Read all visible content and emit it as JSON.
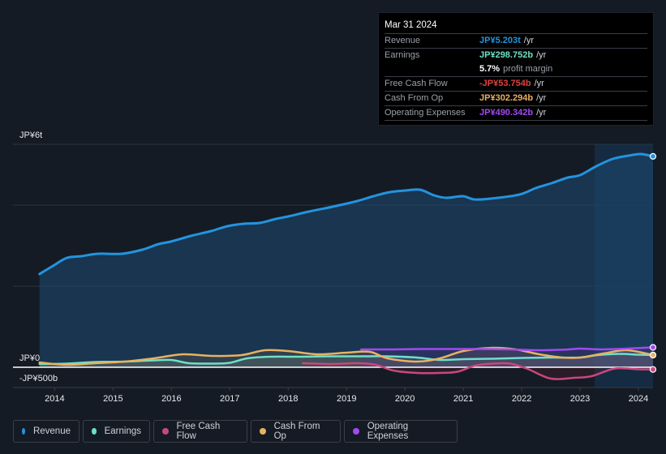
{
  "tooltip": {
    "date": "Mar 31 2024",
    "rows": [
      {
        "label": "Revenue",
        "value": "JP¥5.203t",
        "unit": "/yr",
        "color": "#2394df"
      },
      {
        "label": "Earnings",
        "value": "JP¥298.752b",
        "unit": "/yr",
        "color": "#6ee0c8"
      },
      {
        "label": "",
        "value": "5.7%",
        "unit": "profit margin"
      },
      {
        "label": "Free Cash Flow",
        "value": "-JP¥53.754b",
        "unit": "/yr",
        "color": "#e0413f"
      },
      {
        "label": "Cash From Op",
        "value": "JP¥302.294b",
        "unit": "/yr",
        "color": "#e8b161"
      },
      {
        "label": "Operating Expenses",
        "value": "JP¥490.342b",
        "unit": "/yr",
        "color": "#a349f0"
      }
    ]
  },
  "legend": [
    {
      "label": "Revenue",
      "color": "#2394df"
    },
    {
      "label": "Earnings",
      "color": "#6ee0c8"
    },
    {
      "label": "Free Cash Flow",
      "color": "#c8477f"
    },
    {
      "label": "Cash From Op",
      "color": "#e8b161"
    },
    {
      "label": "Operating Expenses",
      "color": "#a349f0"
    }
  ],
  "chart_data": {
    "type": "area",
    "title": "",
    "xlabel": "",
    "ylabel": "",
    "y_unit": "JP¥ trillions",
    "y_tick_labels": [
      {
        "value": 6,
        "label": "JP¥6t"
      },
      {
        "value": 0,
        "label": "JP¥0"
      },
      {
        "value": -0.5,
        "label": "-JP¥500b"
      }
    ],
    "gridlines": [
      5.5,
      4,
      2,
      0
    ],
    "ylim": [
      -0.5,
      5.5
    ],
    "xlim": [
      2013.73,
      2024.25
    ],
    "x_ticks": [
      2014,
      2015,
      2016,
      2017,
      2018,
      2019,
      2020,
      2021,
      2022,
      2023,
      2024
    ],
    "highlight_from": 2023.25,
    "series": [
      {
        "name": "Revenue",
        "color": "#2394df",
        "points": [
          [
            2013.74,
            2.3
          ],
          [
            2013.97,
            2.5
          ],
          [
            2014.21,
            2.7
          ],
          [
            2014.46,
            2.74
          ],
          [
            2014.74,
            2.8
          ],
          [
            2015.15,
            2.8
          ],
          [
            2015.5,
            2.9
          ],
          [
            2015.78,
            3.04
          ],
          [
            2015.99,
            3.1
          ],
          [
            2016.33,
            3.24
          ],
          [
            2016.68,
            3.36
          ],
          [
            2016.96,
            3.48
          ],
          [
            2017.24,
            3.54
          ],
          [
            2017.51,
            3.56
          ],
          [
            2017.79,
            3.66
          ],
          [
            2018.0,
            3.72
          ],
          [
            2018.35,
            3.84
          ],
          [
            2018.76,
            3.96
          ],
          [
            2019.18,
            4.1
          ],
          [
            2019.46,
            4.22
          ],
          [
            2019.74,
            4.32
          ],
          [
            2020.01,
            4.36
          ],
          [
            2020.26,
            4.38
          ],
          [
            2020.5,
            4.24
          ],
          [
            2020.71,
            4.18
          ],
          [
            2020.99,
            4.22
          ],
          [
            2021.19,
            4.14
          ],
          [
            2021.47,
            4.16
          ],
          [
            2021.96,
            4.26
          ],
          [
            2022.24,
            4.42
          ],
          [
            2022.51,
            4.54
          ],
          [
            2022.79,
            4.68
          ],
          [
            2023.0,
            4.74
          ],
          [
            2023.28,
            4.96
          ],
          [
            2023.56,
            5.14
          ],
          [
            2023.83,
            5.22
          ],
          [
            2024.04,
            5.26
          ],
          [
            2024.25,
            5.203
          ]
        ]
      },
      {
        "name": "Earnings",
        "color": "#6ee0c8",
        "points": [
          [
            2013.74,
            0.08
          ],
          [
            2014.2,
            0.09
          ],
          [
            2014.7,
            0.13
          ],
          [
            2015.2,
            0.14
          ],
          [
            2015.7,
            0.17
          ],
          [
            2016.0,
            0.18
          ],
          [
            2016.3,
            0.1
          ],
          [
            2016.7,
            0.09
          ],
          [
            2017.0,
            0.11
          ],
          [
            2017.3,
            0.22
          ],
          [
            2017.7,
            0.26
          ],
          [
            2018.2,
            0.26
          ],
          [
            2018.7,
            0.27
          ],
          [
            2019.2,
            0.27
          ],
          [
            2019.7,
            0.27
          ],
          [
            2020.2,
            0.24
          ],
          [
            2020.6,
            0.18
          ],
          [
            2021.0,
            0.2
          ],
          [
            2021.5,
            0.21
          ],
          [
            2022.0,
            0.23
          ],
          [
            2022.5,
            0.24
          ],
          [
            2023.0,
            0.24
          ],
          [
            2023.3,
            0.3
          ],
          [
            2023.7,
            0.33
          ],
          [
            2024.0,
            0.31
          ],
          [
            2024.25,
            0.299
          ]
        ]
      },
      {
        "name": "Free Cash Flow",
        "color": "#c8477f",
        "points": [
          [
            2018.25,
            0.1
          ],
          [
            2018.7,
            0.08
          ],
          [
            2019.2,
            0.1
          ],
          [
            2019.5,
            0.06
          ],
          [
            2019.8,
            -0.08
          ],
          [
            2020.2,
            -0.14
          ],
          [
            2020.6,
            -0.14
          ],
          [
            2020.9,
            -0.11
          ],
          [
            2021.2,
            0.04
          ],
          [
            2021.5,
            0.09
          ],
          [
            2021.8,
            0.09
          ],
          [
            2022.1,
            -0.04
          ],
          [
            2022.5,
            -0.28
          ],
          [
            2022.9,
            -0.26
          ],
          [
            2023.2,
            -0.22
          ],
          [
            2023.6,
            -0.03
          ],
          [
            2024.0,
            -0.05
          ],
          [
            2024.25,
            -0.054
          ]
        ]
      },
      {
        "name": "Cash From Op",
        "color": "#e8b161",
        "points": [
          [
            2013.74,
            0.12
          ],
          [
            2014.2,
            0.06
          ],
          [
            2014.7,
            0.1
          ],
          [
            2015.2,
            0.14
          ],
          [
            2015.7,
            0.22
          ],
          [
            2016.2,
            0.32
          ],
          [
            2016.7,
            0.28
          ],
          [
            2017.2,
            0.3
          ],
          [
            2017.6,
            0.42
          ],
          [
            2018.0,
            0.4
          ],
          [
            2018.5,
            0.32
          ],
          [
            2019.0,
            0.36
          ],
          [
            2019.4,
            0.38
          ],
          [
            2019.7,
            0.22
          ],
          [
            2020.2,
            0.14
          ],
          [
            2020.6,
            0.22
          ],
          [
            2021.0,
            0.4
          ],
          [
            2021.5,
            0.48
          ],
          [
            2021.9,
            0.44
          ],
          [
            2022.3,
            0.32
          ],
          [
            2022.7,
            0.24
          ],
          [
            2023.0,
            0.24
          ],
          [
            2023.4,
            0.34
          ],
          [
            2023.8,
            0.42
          ],
          [
            2024.25,
            0.302
          ]
        ]
      },
      {
        "name": "Operating Expenses",
        "color": "#a349f0",
        "points": [
          [
            2019.25,
            0.44
          ],
          [
            2019.8,
            0.44
          ],
          [
            2020.3,
            0.45
          ],
          [
            2020.8,
            0.45
          ],
          [
            2021.3,
            0.45
          ],
          [
            2021.8,
            0.44
          ],
          [
            2022.3,
            0.42
          ],
          [
            2022.8,
            0.44
          ],
          [
            2023.0,
            0.46
          ],
          [
            2023.4,
            0.44
          ],
          [
            2023.8,
            0.46
          ],
          [
            2024.25,
            0.49
          ]
        ]
      }
    ]
  }
}
